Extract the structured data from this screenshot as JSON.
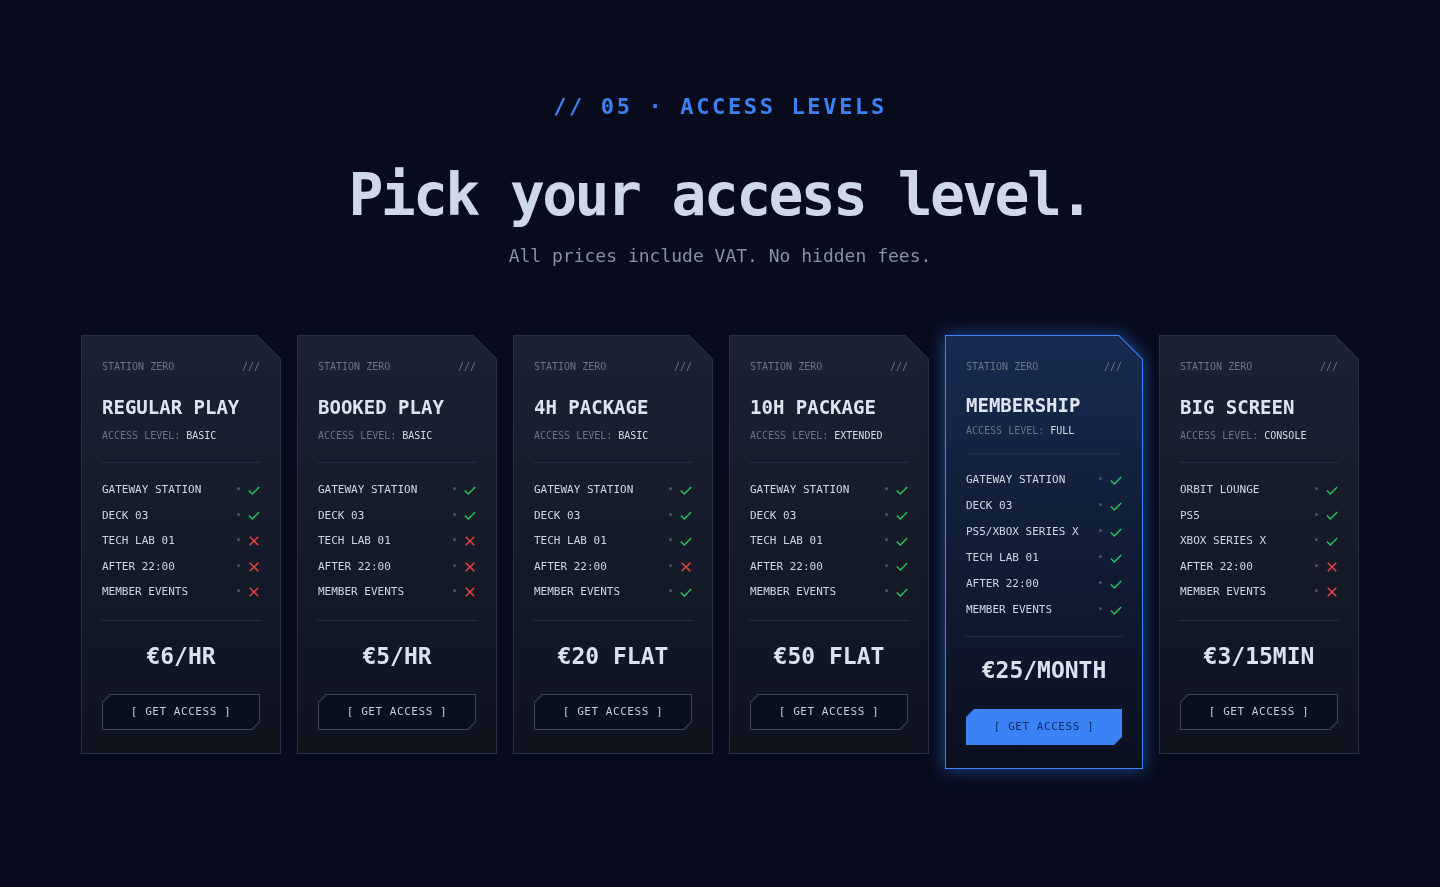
{
  "section": {
    "eyebrow": "// 05 · ACCESS LEVELS",
    "title": "Pick your access level.",
    "subtitle": "All prices include VAT. No hidden fees."
  },
  "plans": [
    {
      "brand": "STATION ZERO",
      "corner_mark": "///",
      "name": "REGULAR PLAY",
      "access_label": "ACCESS LEVEL:",
      "access_value": "BASIC",
      "featured": false,
      "features": [
        {
          "label": "GATEWAY STATION",
          "included": true
        },
        {
          "label": "DECK 03",
          "included": true
        },
        {
          "label": "TECH LAB 01",
          "included": false
        },
        {
          "label": "AFTER 22:00",
          "included": false
        },
        {
          "label": "MEMBER EVENTS",
          "included": false
        }
      ],
      "price": "€6/HR",
      "button": "[ GET ACCESS ]"
    },
    {
      "brand": "STATION ZERO",
      "corner_mark": "///",
      "name": "BOOKED PLAY",
      "access_label": "ACCESS LEVEL:",
      "access_value": "BASIC",
      "featured": false,
      "features": [
        {
          "label": "GATEWAY STATION",
          "included": true
        },
        {
          "label": "DECK 03",
          "included": true
        },
        {
          "label": "TECH LAB 01",
          "included": false
        },
        {
          "label": "AFTER 22:00",
          "included": false
        },
        {
          "label": "MEMBER EVENTS",
          "included": false
        }
      ],
      "price": "€5/HR",
      "button": "[ GET ACCESS ]"
    },
    {
      "brand": "STATION ZERO",
      "corner_mark": "///",
      "name": "4H PACKAGE",
      "access_label": "ACCESS LEVEL:",
      "access_value": "BASIC",
      "featured": false,
      "features": [
        {
          "label": "GATEWAY STATION",
          "included": true
        },
        {
          "label": "DECK 03",
          "included": true
        },
        {
          "label": "TECH LAB 01",
          "included": true
        },
        {
          "label": "AFTER 22:00",
          "included": false
        },
        {
          "label": "MEMBER EVENTS",
          "included": true
        }
      ],
      "price": "€20 FLAT",
      "button": "[ GET ACCESS ]"
    },
    {
      "brand": "STATION ZERO",
      "corner_mark": "///",
      "name": "10H PACKAGE",
      "access_label": "ACCESS LEVEL:",
      "access_value": "EXTENDED",
      "featured": false,
      "features": [
        {
          "label": "GATEWAY STATION",
          "included": true
        },
        {
          "label": "DECK 03",
          "included": true
        },
        {
          "label": "TECH LAB 01",
          "included": true
        },
        {
          "label": "AFTER 22:00",
          "included": true
        },
        {
          "label": "MEMBER EVENTS",
          "included": true
        }
      ],
      "price": "€50 FLAT",
      "button": "[ GET ACCESS ]"
    },
    {
      "brand": "STATION ZERO",
      "corner_mark": "///",
      "name": "MEMBERSHIP",
      "access_label": "ACCESS LEVEL:",
      "access_value": "FULL",
      "featured": true,
      "features": [
        {
          "label": "GATEWAY STATION",
          "included": true
        },
        {
          "label": "DECK 03",
          "included": true
        },
        {
          "label": "PS5/XBOX SERIES X",
          "included": true
        },
        {
          "label": "TECH LAB 01",
          "included": true
        },
        {
          "label": "AFTER 22:00",
          "included": true
        },
        {
          "label": "MEMBER EVENTS",
          "included": true
        }
      ],
      "price": "€25/MONTH",
      "button": "[ GET ACCESS ]"
    },
    {
      "brand": "STATION ZERO",
      "corner_mark": "///",
      "name": "BIG SCREEN",
      "access_label": "ACCESS LEVEL:",
      "access_value": "CONSOLE",
      "featured": false,
      "features": [
        {
          "label": "ORBIT LOUNGE",
          "included": true
        },
        {
          "label": "PS5",
          "included": true
        },
        {
          "label": "XBOX SERIES X",
          "included": true
        },
        {
          "label": "AFTER 22:00",
          "included": false
        },
        {
          "label": "MEMBER EVENTS",
          "included": false
        }
      ],
      "price": "€3/15MIN",
      "button": "[ GET ACCESS ]"
    }
  ]
}
